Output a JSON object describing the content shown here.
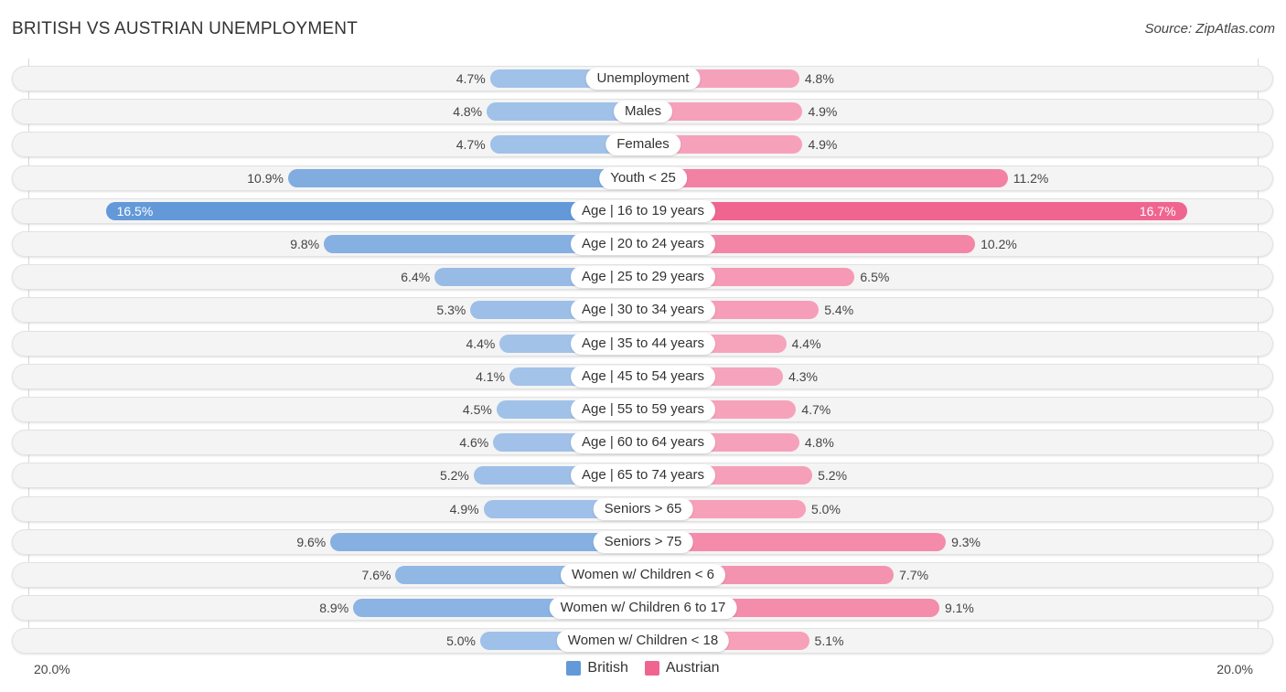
{
  "title": "BRITISH VS AUSTRIAN UNEMPLOYMENT",
  "source": "Source: ZipAtlas.com",
  "legend": [
    {
      "name": "British",
      "color": "#6399d9"
    },
    {
      "name": "Austrian",
      "color": "#f0658f"
    }
  ],
  "axis": {
    "left_label": "20.0%",
    "right_label": "20.0%"
  },
  "chart_data": {
    "type": "bar",
    "orientation": "horizontal-diverging",
    "title": "BRITISH VS AUSTRIAN UNEMPLOYMENT",
    "xlabel": "",
    "ylabel": "",
    "xlim": [
      -20,
      20
    ],
    "unit": "%",
    "legend_position": "bottom-center",
    "categories": [
      "Unemployment",
      "Males",
      "Females",
      "Youth < 25",
      "Age | 16 to 19 years",
      "Age | 20 to 24 years",
      "Age | 25 to 29 years",
      "Age | 30 to 34 years",
      "Age | 35 to 44 years",
      "Age | 45 to 54 years",
      "Age | 55 to 59 years",
      "Age | 60 to 64 years",
      "Age | 65 to 74 years",
      "Seniors > 65",
      "Seniors > 75",
      "Women w/ Children < 6",
      "Women w/ Children 6 to 17",
      "Women w/ Children < 18"
    ],
    "series": [
      {
        "name": "British",
        "color": "#6399d9",
        "values": [
          4.7,
          4.8,
          4.7,
          10.9,
          16.5,
          9.8,
          6.4,
          5.3,
          4.4,
          4.1,
          4.5,
          4.6,
          5.2,
          4.9,
          9.6,
          7.6,
          8.9,
          5.0
        ],
        "labels": [
          "4.7%",
          "4.8%",
          "4.7%",
          "10.9%",
          "16.5%",
          "9.8%",
          "6.4%",
          "5.3%",
          "4.4%",
          "4.1%",
          "4.5%",
          "4.6%",
          "5.2%",
          "4.9%",
          "9.6%",
          "7.6%",
          "8.9%",
          "5.0%"
        ]
      },
      {
        "name": "Austrian",
        "color": "#f0658f",
        "values": [
          4.8,
          4.9,
          4.9,
          11.2,
          16.7,
          10.2,
          6.5,
          5.4,
          4.4,
          4.3,
          4.7,
          4.8,
          5.2,
          5.0,
          9.3,
          7.7,
          9.1,
          5.1
        ],
        "labels": [
          "4.8%",
          "4.9%",
          "4.9%",
          "11.2%",
          "16.7%",
          "10.2%",
          "6.5%",
          "5.4%",
          "4.4%",
          "4.3%",
          "4.7%",
          "4.8%",
          "5.2%",
          "5.0%",
          "9.3%",
          "7.7%",
          "9.1%",
          "5.1%"
        ]
      }
    ]
  }
}
